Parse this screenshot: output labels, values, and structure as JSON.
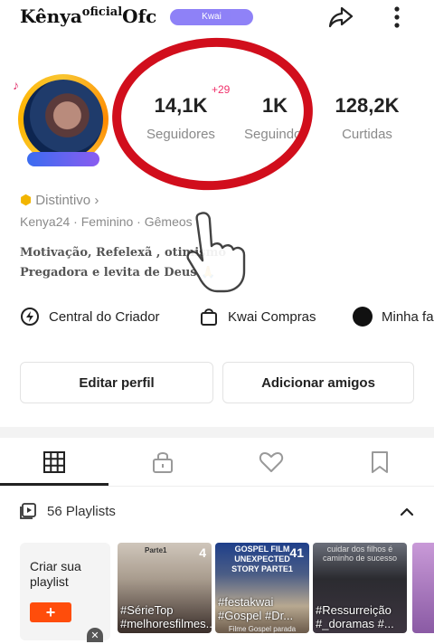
{
  "header": {
    "name": "Kênya",
    "name_super": "oficial",
    "name_suffix": "Ofc",
    "badge": "Kwai",
    "share_icon": "share-arrow-icon",
    "more_icon": "more-vertical-icon"
  },
  "stats": [
    {
      "value": "14,1K",
      "label": "Seguidores",
      "delta": "+29"
    },
    {
      "value": "1K",
      "label": "Seguindo"
    },
    {
      "value": "128,2K",
      "label": "Curtidas"
    }
  ],
  "profile": {
    "verify_label": "Distintivo",
    "meta": "Kenya24 · Feminino · Gêmeos",
    "bio_line1": "Motivação, Refelexã , otimismo",
    "bio_line2": "Pregadora e levita de Deus 🙏"
  },
  "shortcuts": [
    {
      "label": "Central do Criador",
      "icon": "bolt-circle-icon"
    },
    {
      "label": "Kwai Compras",
      "icon": "shopping-bag-icon"
    },
    {
      "label": "Minha fa",
      "icon": "black-circle-icon"
    }
  ],
  "buttons": {
    "edit": "Editar perfil",
    "add_friends": "Adicionar amigos"
  },
  "tabs": [
    {
      "name": "grid",
      "icon": "grid-icon"
    },
    {
      "name": "private",
      "icon": "lock-icon"
    },
    {
      "name": "likes",
      "icon": "heart-icon"
    },
    {
      "name": "saved",
      "icon": "bookmark-icon"
    }
  ],
  "playlists": {
    "title": "56 Playlists",
    "create_label": "Criar sua playlist",
    "create_button": "+",
    "items": [
      {
        "count": "4",
        "tags": "#SérieTop #melhoresfilmes...",
        "banner": "Parte1",
        "sub": ""
      },
      {
        "count": "41",
        "tags": "#festakwai #Gospel #Dr...",
        "banner": "GOSPEL FILM UNEXPECTED STORY PARTE1",
        "sub": "Filme Gospel parada"
      },
      {
        "count": "",
        "tags": "#Ressurreição #_doramas #...",
        "banner": "cuidar dos filhos é caminho de sucesso",
        "sub": ""
      }
    ]
  },
  "colors": {
    "highlight": "#d10e1c",
    "accent": "#ff4d0b",
    "delta": "#f0306a"
  }
}
